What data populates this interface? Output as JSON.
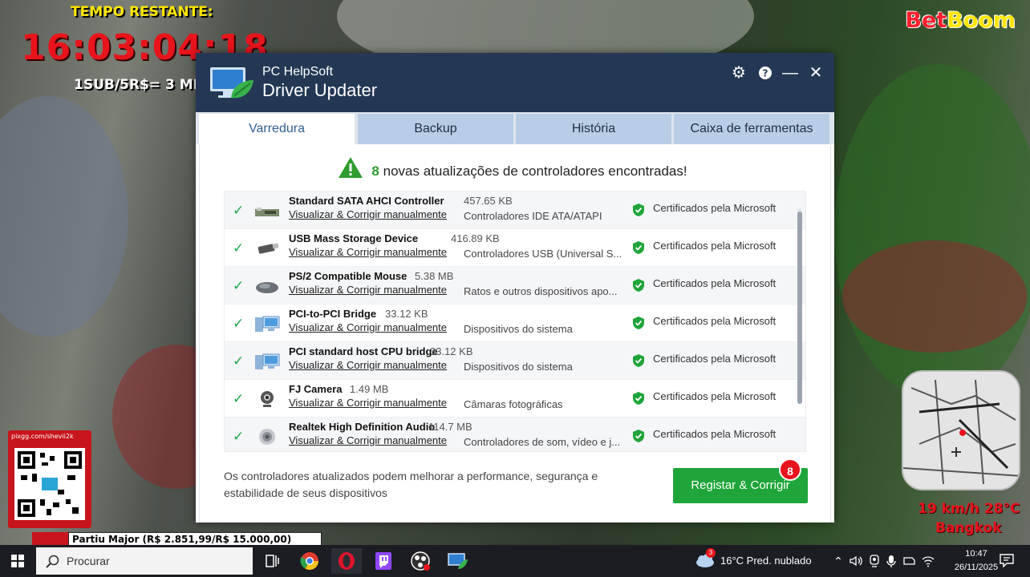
{
  "stream": {
    "timer_label": "TEMPO RESTANTE:",
    "timer": "16:03:04:18",
    "sub_rate": "1SUB/5R$= 3 MI",
    "brand_bet": "Bet",
    "brand_boom": "Boom",
    "qr_url": "pixgg.com/shevii2k",
    "goal": "Partiu Major (R$ 2.851,99/R$ 15.000,00)",
    "speed_temp": "19 km/h 28°C",
    "city": "Bangkok"
  },
  "app": {
    "brand": "PC HelpSoft",
    "title": "Driver Updater",
    "tabs": [
      "Varredura",
      "Backup",
      "História",
      "Caixa de ferramentas"
    ],
    "active_tab": "Varredura",
    "headline_count": "8",
    "headline_text": "novas atualizações de controladores encontradas!",
    "drivers": [
      {
        "name": "Standard SATA AHCI Controller",
        "size": "457.65 KB",
        "link": "Visualizar & Corrigir manualmente",
        "category": "Controladores IDE ATA/ATAPI",
        "cert": "Certificados pela Microsoft",
        "icon": "sata-controller-icon"
      },
      {
        "name": "USB Mass Storage Device",
        "size": "416.89 KB",
        "link": "Visualizar & Corrigir manualmente",
        "category": "Controladores USB (Universal S...",
        "cert": "Certificados pela Microsoft",
        "icon": "usb-drive-icon"
      },
      {
        "name": "PS/2 Compatible Mouse",
        "size": "5.38 MB",
        "link": "Visualizar & Corrigir manualmente",
        "category": "Ratos e outros dispositivos apo...",
        "cert": "Certificados pela Microsoft",
        "icon": "mouse-icon"
      },
      {
        "name": "PCI-to-PCI Bridge",
        "size": "33.12 KB",
        "link": "Visualizar & Corrigir manualmente",
        "category": "Dispositivos do sistema",
        "cert": "Certificados pela Microsoft",
        "icon": "computer-icon"
      },
      {
        "name": "PCI standard host CPU bridge",
        "size": "33.12 KB",
        "link": "Visualizar & Corrigir manualmente",
        "category": "Dispositivos do sistema",
        "cert": "Certificados pela Microsoft",
        "icon": "computer-icon"
      },
      {
        "name": "FJ Camera",
        "size": "1.49 MB",
        "link": "Visualizar & Corrigir manualmente",
        "category": "Câmaras fotográficas",
        "cert": "Certificados pela Microsoft",
        "icon": "webcam-icon"
      },
      {
        "name": "Realtek High Definition Audio",
        "size": "114.7 MB",
        "link": "Visualizar & Corrigir manualmente",
        "category": "Controladores de som, vídeo e j...",
        "cert": "Certificados pela Microsoft",
        "icon": "speaker-icon"
      }
    ],
    "footer_text": "Os controladores atualizados podem melhorar a performance, segurança e estabilidade de seus dispositivos",
    "fix_button": "Registar & Corrigir",
    "fix_badge": "8",
    "colors": {
      "titlebar": "#243855",
      "accent_green": "#1fa53a",
      "badge_red": "#e8141c",
      "tab_inactive": "#b9cde6"
    }
  },
  "taskbar": {
    "search_placeholder": "Procurar",
    "weather_badge": "3",
    "weather": "16°C  Pred. nublado",
    "time": "10:47",
    "date": "26/11/2025"
  }
}
